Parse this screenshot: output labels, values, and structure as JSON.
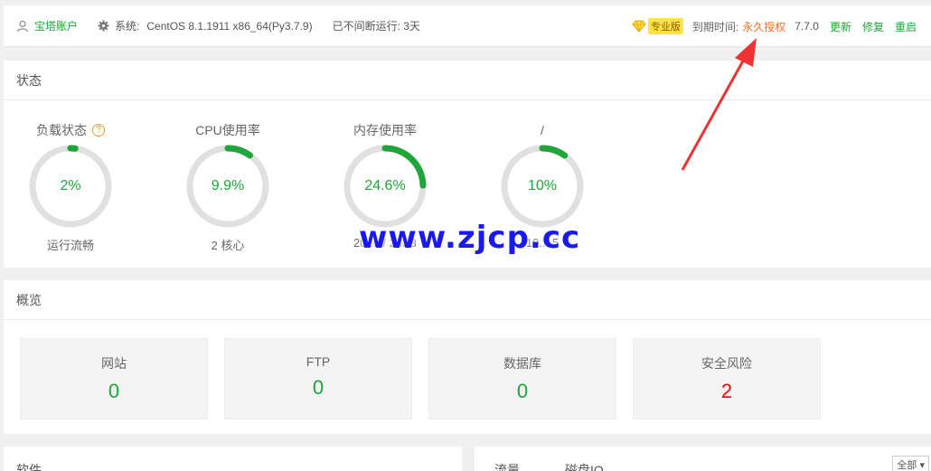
{
  "topbar": {
    "account_label": "宝塔账户",
    "system_prefix": "系统:",
    "system_value": "CentOS 8.1.1911 x86_64(Py3.7.9)",
    "uptime": "已不间断运行: 3天",
    "edition": "专业版",
    "expire_label": "到期时间:",
    "expire_value": "永久授权",
    "version": "7.7.0",
    "links": {
      "update": "更新",
      "repair": "修复",
      "restart": "重启"
    }
  },
  "status": {
    "title": "状态",
    "gauges": [
      {
        "label": "负载状态",
        "value": "2%",
        "percent": 0.02,
        "sub": "运行流畅"
      },
      {
        "label": "CPU使用率",
        "value": "9.9%",
        "percent": 0.099,
        "sub": "2 核心"
      },
      {
        "label": "内存使用率",
        "value": "24.6%",
        "percent": 0.246,
        "sub": "2020 / 2 MB"
      },
      {
        "label": "/",
        "value": "10%",
        "percent": 0.1,
        "sub": "10... 5"
      }
    ]
  },
  "overview": {
    "title": "概览",
    "cards": [
      {
        "label": "网站",
        "value": "0"
      },
      {
        "label": "FTP",
        "value": "0"
      },
      {
        "label": "数据库",
        "value": "0"
      },
      {
        "label": "安全风险",
        "value": "2"
      }
    ]
  },
  "bottom": {
    "software_title": "软件",
    "traffic_tab": "流量",
    "diskio_tab": "磁盘IO",
    "select_value": "全部"
  },
  "watermark": "www.zjcp.cc",
  "colors": {
    "accent": "#20a53a",
    "danger": "#ff0000",
    "expire": "#fc6d26",
    "ring_bg": "#e0e0e0"
  }
}
